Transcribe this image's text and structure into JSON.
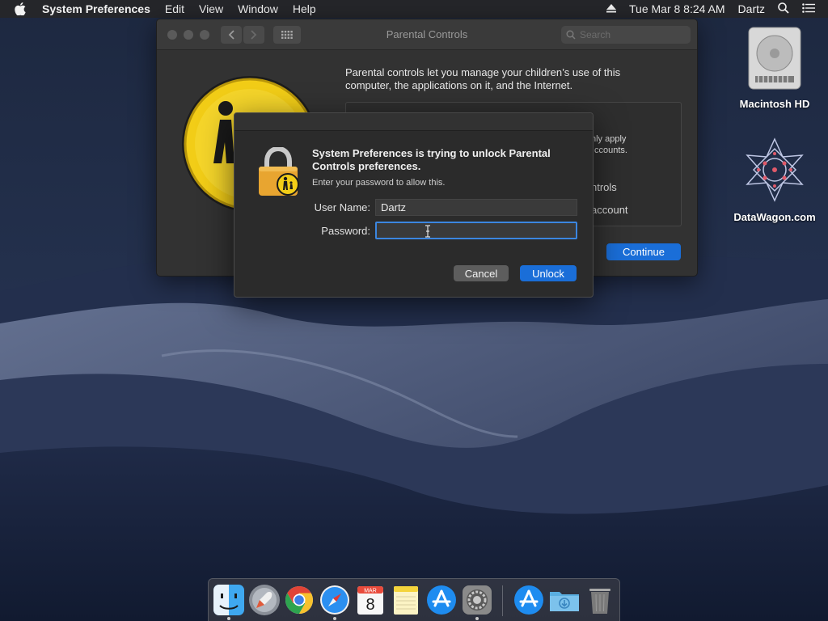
{
  "menubar": {
    "app_name": "System Preferences",
    "items": [
      "Edit",
      "View",
      "Window",
      "Help"
    ],
    "clock": "Tue Mar 8  8:24 AM",
    "user": "Dartz",
    "icons": [
      "apple-icon",
      "eject-icon",
      "spotlight-search-icon",
      "notification-center-icon"
    ]
  },
  "desktop": {
    "icons": [
      {
        "label": "Macintosh HD",
        "icon": "hard-drive-icon"
      },
      {
        "label": "DataWagon.com",
        "icon": "datawagon-logo-icon"
      }
    ]
  },
  "prefs_window": {
    "title": "Parental Controls",
    "search_placeholder": "Search",
    "intro": "Parental controls let you manage your children’s use of this computer, the applications on it, and the Internet.",
    "box_lines": {
      "line1": "nly apply",
      "line2": "ccounts.",
      "line3": "ntrols",
      "line4": "account"
    },
    "continue_label": "Continue"
  },
  "dialog": {
    "heading": "System Preferences is trying to unlock Parental Controls preferences.",
    "subtext": "Enter your password to allow this.",
    "username_label": "User Name:",
    "username_value": "Dartz",
    "password_label": "Password:",
    "password_value": "",
    "cancel_label": "Cancel",
    "unlock_label": "Unlock"
  },
  "dock": {
    "apps": [
      {
        "name": "Finder",
        "icon": "finder-icon",
        "running": true
      },
      {
        "name": "Launchpad",
        "icon": "launchpad-icon",
        "running": false
      },
      {
        "name": "Google Chrome",
        "icon": "chrome-icon",
        "running": false
      },
      {
        "name": "Safari",
        "icon": "safari-icon",
        "running": true
      },
      {
        "name": "Calendar",
        "icon": "calendar-icon",
        "running": false,
        "month": "MAR",
        "day": "8"
      },
      {
        "name": "Notes",
        "icon": "notes-icon",
        "running": false
      },
      {
        "name": "App Store",
        "icon": "app-store-icon",
        "running": false
      },
      {
        "name": "System Preferences",
        "icon": "system-preferences-icon",
        "running": true
      },
      {
        "name": "App Store",
        "icon": "app-store-icon-2",
        "running": false
      },
      {
        "name": "Downloads",
        "icon": "downloads-folder-icon",
        "running": false
      },
      {
        "name": "Trash",
        "icon": "trash-icon",
        "running": false
      }
    ]
  },
  "colors": {
    "accent": "#1a6ed8",
    "focus_ring": "#3b86e0",
    "window_bg": "#323232",
    "dialog_bg": "#2b2b2b"
  }
}
